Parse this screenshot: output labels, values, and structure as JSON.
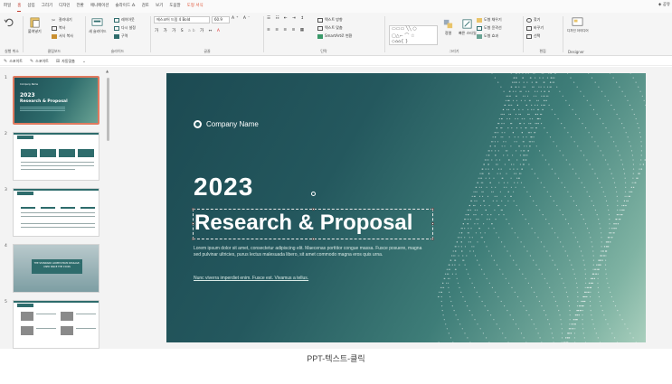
{
  "menu": {
    "items": [
      "파일",
      "홈",
      "삽입",
      "그리기",
      "디자인",
      "전환",
      "애니메이션",
      "슬라이드 쇼",
      "검토",
      "보기",
      "도움말",
      "도형 서식"
    ],
    "active_index": 1,
    "share_label": "공유"
  },
  "ribbon": {
    "undo_label": "실행 취소",
    "clipboard": {
      "paste": "붙여넣기",
      "cut": "잘라내기",
      "copy": "복사",
      "format_painter": "서식 복사",
      "label": "클립보드"
    },
    "slides": {
      "new_slide": "새 슬라이드",
      "layout": "레이아웃",
      "reset": "다시 설정",
      "section": "구역",
      "label": "슬라이드"
    },
    "font": {
      "font_name": "에스코어 드림 4 Bold",
      "font_size": "60.9",
      "label": "글꼴"
    },
    "paragraph": {
      "text_direction": "텍스트 방향",
      "align_text": "텍스트 맞춤",
      "smartart": "SmartArt로 변환",
      "label": "단락"
    },
    "drawing": {
      "arrange": "정렬",
      "quick_styles": "빠른 스타일",
      "fill": "도형 채우기",
      "outline": "도형 윤곽선",
      "effects": "도형 효과",
      "label": "그리기"
    },
    "editing": {
      "find": "찾기",
      "replace": "바꾸기",
      "select": "선택",
      "label": "편집"
    },
    "designer": {
      "button": "디자인 아이디어",
      "label": "Designer"
    }
  },
  "quickbar": {
    "items": [
      "스포이트",
      "스포이트",
      "자동맞춤"
    ]
  },
  "thumbnails": [
    {
      "number": "1",
      "company": "Company Name",
      "year": "2023",
      "title": "Research & Proposal"
    },
    {
      "number": "2"
    },
    {
      "number": "3"
    },
    {
      "number": "4",
      "banner": "THE STANDARD LOREM IPSUM PASSAGE, USED SINCE THE 1500S"
    },
    {
      "number": "5"
    }
  ],
  "slide": {
    "company_name": "Company Name",
    "year": "2023",
    "title": "Research & Proposal",
    "body1": "Lorem ipsum dolor sit amet, consectetur adipiscing elit. Maecenas porttitor congue massa. Fusce posuere, magna sed pulvinar ultricies, purus lectus malesuada libero, sit amet commodo magna eros quis urna.",
    "body2": "Nunc viverra imperdiet enim. Fusce est. Vivamus a tellus."
  },
  "caption": "PPT-텍스트-클릭",
  "colors": {
    "accent": "#c0392b",
    "slide_dark": "#1c4a52",
    "slide_light": "#a9cfbd",
    "selection": "#e07a5f"
  }
}
